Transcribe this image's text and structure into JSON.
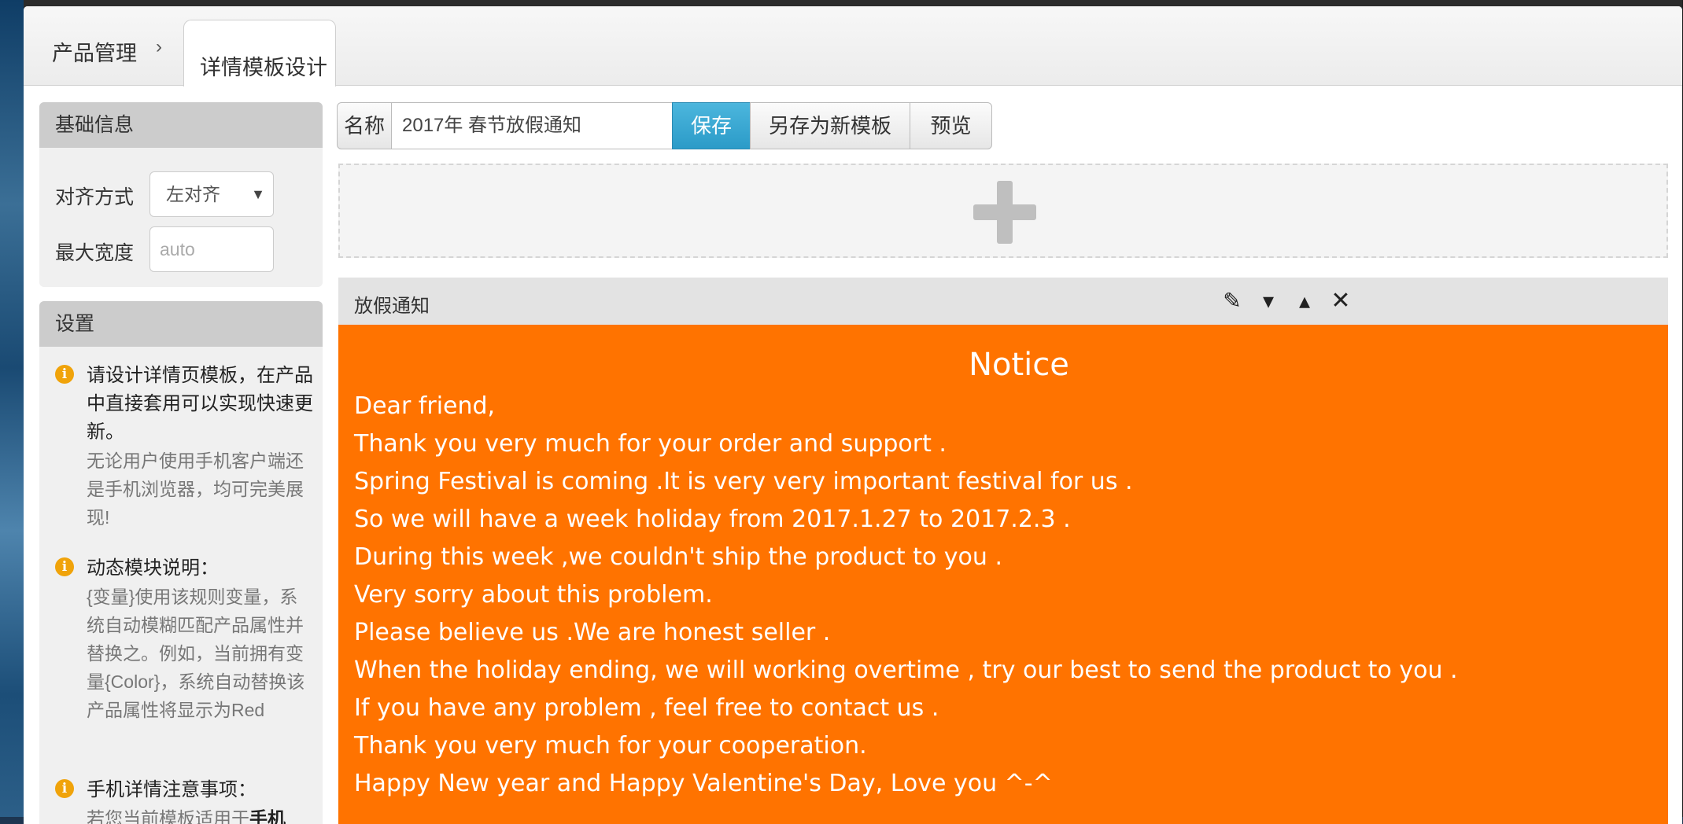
{
  "breadcrumb": {
    "root": "产品管理",
    "separator": "›",
    "active_tab": "详情模板设计"
  },
  "basic_info": {
    "title": "基础信息",
    "align_label": "对齐方式",
    "align_value": "左对齐",
    "width_label": "最大宽度",
    "width_placeholder": "auto"
  },
  "settings": {
    "title": "设置",
    "items": [
      {
        "title": "请设计详情页模板，在产品中直接套用可以实现快速更新。",
        "desc": "无论用户使用手机客户端还是手机浏览器，均可完美展现!"
      },
      {
        "title": "动态模块说明：",
        "desc": "{变量}使用该规则变量，系统自动模糊匹配产品属性并替换之。例如，当前拥有变量{Color}，系统自动替换该产品属性将显示为Red"
      },
      {
        "title": "手机详情注意事项：",
        "desc_prefix": "若您当前模板适用于",
        "desc_bold": "手机"
      }
    ]
  },
  "toolbar": {
    "name_label": "名称",
    "name_value": "2017年 春节放假通知",
    "save_label": "保存",
    "save_as_label": "另存为新模板",
    "preview_label": "预览"
  },
  "block": {
    "title": "放假通知",
    "icons": [
      "edit-icon",
      "move-down-icon",
      "move-up-icon",
      "close-icon"
    ],
    "background": "#ff7300",
    "heading": "Notice",
    "lines": [
      "Dear friend,",
      "Thank you very much for your order and support .",
      "Spring Festival is coming .It is very very important festival for us .",
      "So we will have a week holiday from 2017.1.27 to 2017.2.3 .",
      "During this week ,we couldn't ship the product to you .",
      "Very sorry about this problem.",
      "Please believe us .We are honest seller .",
      "When the holiday ending, we will working overtime , try our best to send the product to you .",
      "If you have any problem  , feel free to contact us .",
      "Thank you very much for your cooperation.",
      "Happy New year and Happy Valentine's Day, Love you   ^-^"
    ]
  },
  "colors": {
    "accent": "#2b9bc8",
    "info": "#f0a30a"
  }
}
